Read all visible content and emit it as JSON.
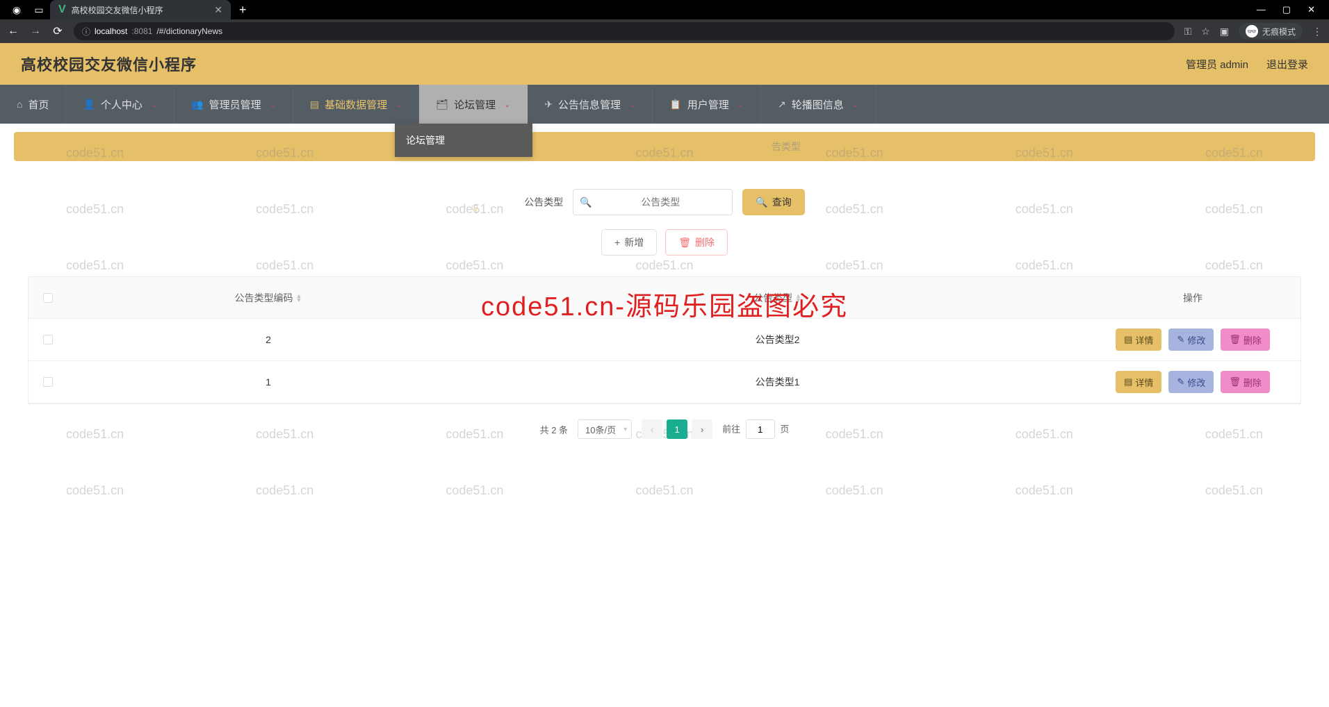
{
  "browser": {
    "tab_title": "高校校园交友微信小程序",
    "url_host": "localhost",
    "url_port": ":8081",
    "url_path": "/#/dictionaryNews",
    "incognito": "无痕模式"
  },
  "app": {
    "title": "高校校园交友微信小程序",
    "user_label": "管理员 admin",
    "logout": "退出登录"
  },
  "nav": {
    "home": "首页",
    "personal": "个人中心",
    "admin_mgmt": "管理员管理",
    "base_data": "基础数据管理",
    "forum_mgmt": "论坛管理",
    "notice_mgmt": "公告信息管理",
    "user_mgmt": "用户管理",
    "carousel": "轮播图信息"
  },
  "dropdown": {
    "item1": "论坛管理"
  },
  "crumb": {
    "text": "告类型"
  },
  "search": {
    "label": "公告类型",
    "placeholder": "公告类型",
    "query_btn": "查询"
  },
  "actions": {
    "add": "新增",
    "delete": "删除"
  },
  "table": {
    "col1": "公告类型编码",
    "col2": "公告类型",
    "col3": "操作",
    "rows": [
      {
        "code": "2",
        "name": "公告类型2"
      },
      {
        "code": "1",
        "name": "公告类型1"
      }
    ],
    "detail_btn": "详情",
    "edit_btn": "修改",
    "del_btn": "删除"
  },
  "pagination": {
    "total": "共 2 条",
    "page_size": "10条/页",
    "current": "1",
    "goto_prefix": "前往",
    "goto_value": "1",
    "goto_suffix": "页"
  },
  "watermark": {
    "text": "code51.cn",
    "big": "code51.cn-源码乐园盗图必究"
  }
}
